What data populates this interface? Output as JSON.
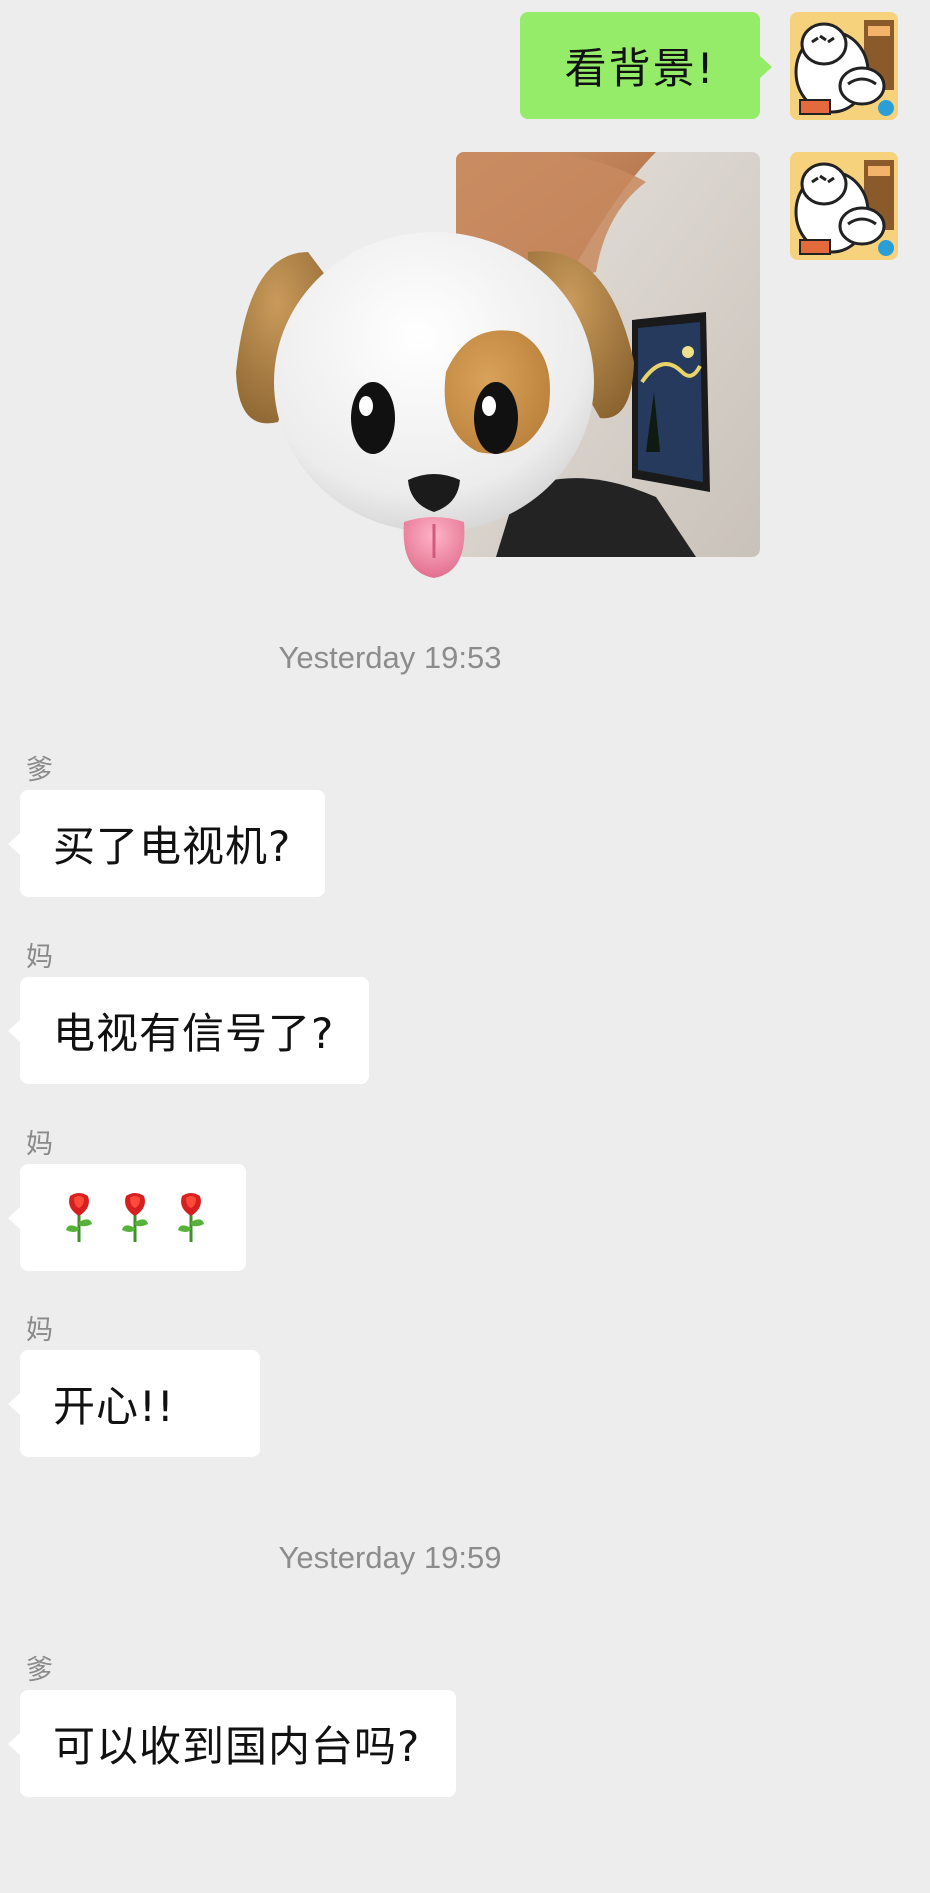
{
  "colors": {
    "background": "#ededed",
    "outgoing_bubble": "#95ec69",
    "incoming_bubble": "#ffffff",
    "timestamp_text": "#8c8c8c"
  },
  "messages_out": [
    {
      "text": "看背景!",
      "avatar_icon": "cartoon-eating-avatar-icon"
    },
    {
      "type": "image",
      "content": "selfie-photo",
      "sticker_icon": "dog-face-emoji-icon",
      "avatar_icon": "cartoon-eating-avatar-icon"
    }
  ],
  "timestamps": [
    "Yesterday 19:53",
    "Yesterday 19:59"
  ],
  "messages_in": [
    {
      "sender": "爹",
      "text": "买了电视机?"
    },
    {
      "sender": "妈",
      "text": "电视有信号了?"
    },
    {
      "sender": "妈",
      "emojis": [
        "rose-icon",
        "rose-icon",
        "rose-icon"
      ]
    },
    {
      "sender": "妈",
      "text": "开心!!"
    },
    {
      "sender": "爹",
      "text": "可以收到国内台吗?"
    }
  ]
}
